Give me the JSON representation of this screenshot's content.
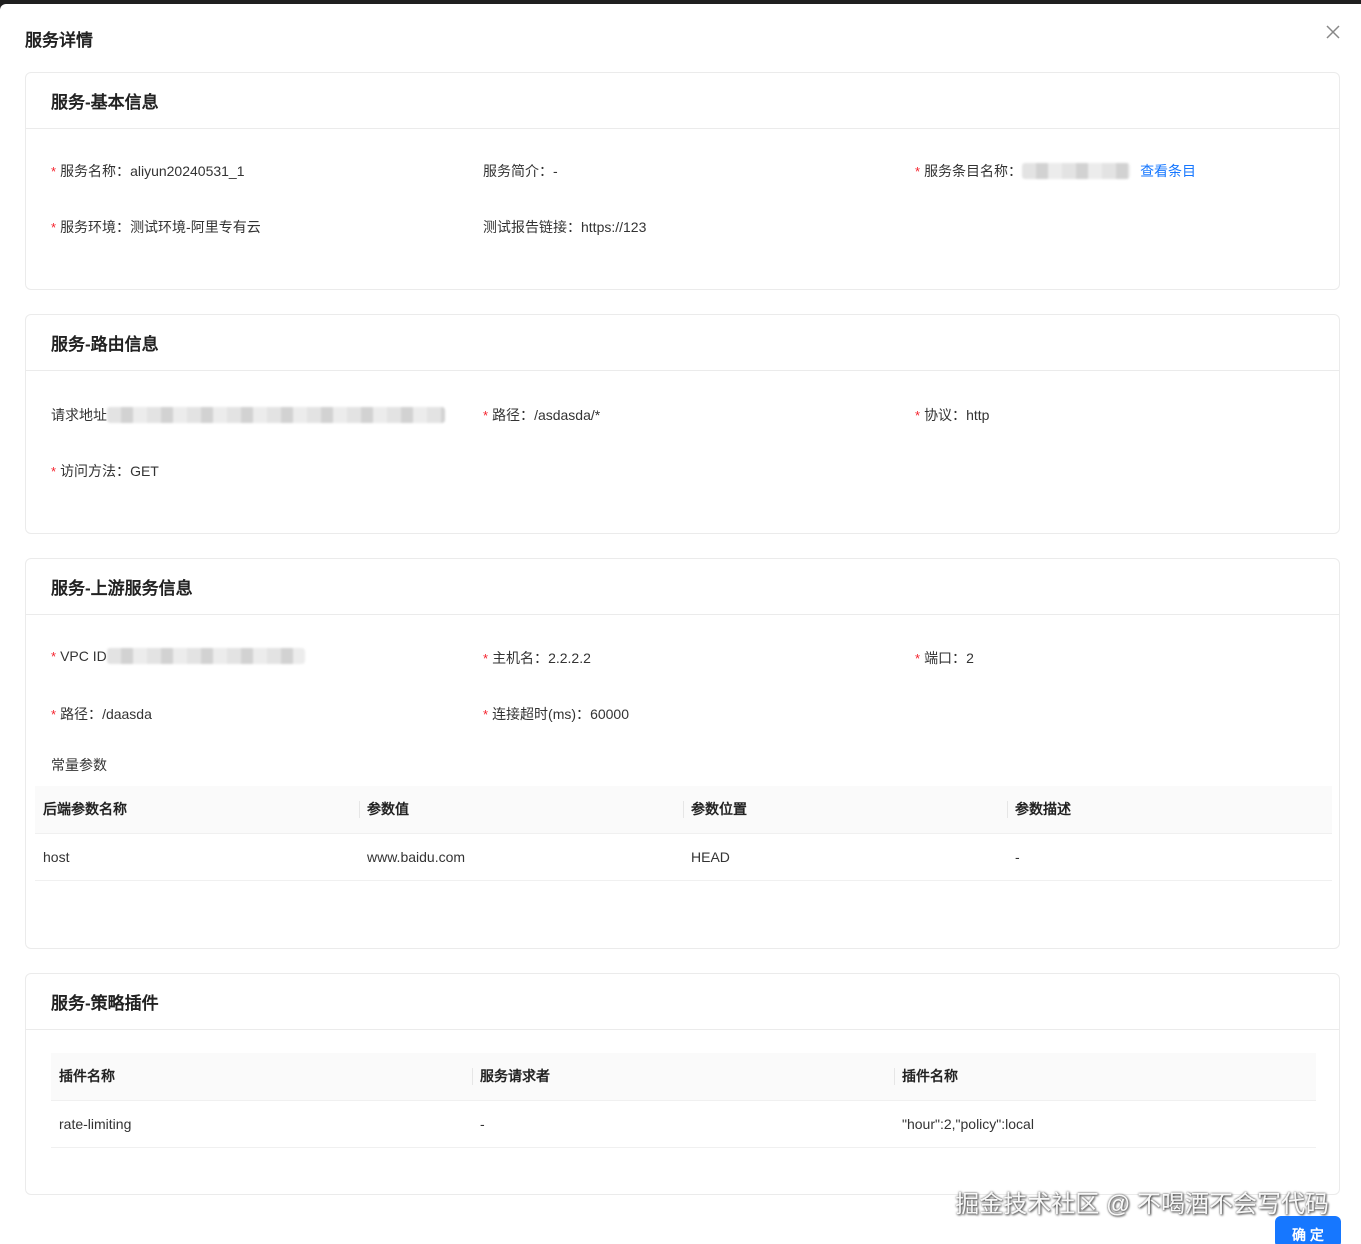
{
  "modal": {
    "title": "服务详情",
    "ok_label": "确 定"
  },
  "basic": {
    "title": "服务-基本信息",
    "name_label": "服务名称：",
    "name_value": "aliyun20240531_1",
    "intro_label": "服务简介：",
    "intro_value": "-",
    "item_label": "服务条目名称：",
    "item_link": "查看条目",
    "env_label": "服务环境：",
    "env_value": "测试环境-阿里专有云",
    "report_label": "测试报告链接：",
    "report_value": "https://123"
  },
  "route": {
    "title": "服务-路由信息",
    "addr_label": "请求地址",
    "path_label": "路径：",
    "path_value": "/asdasda/*",
    "proto_label": "协议：",
    "proto_value": "http",
    "method_label": "访问方法：",
    "method_value": "GET"
  },
  "upstream": {
    "title": "服务-上游服务信息",
    "vpc_label": "VPC ID",
    "host_label": "主机名：",
    "host_value": "2.2.2.2",
    "port_label": "端口：",
    "port_value": "2",
    "path_label": "路径：",
    "path_value": "/daasda",
    "timeout_label": "连接超时(ms)：",
    "timeout_value": "60000",
    "params_label": "常量参数",
    "params_headers": [
      "后端参数名称",
      "参数值",
      "参数位置",
      "参数描述"
    ],
    "params_rows": [
      [
        "host",
        "www.baidu.com",
        "HEAD",
        "-"
      ]
    ]
  },
  "plugins": {
    "title": "服务-策略插件",
    "headers": [
      "插件名称",
      "服务请求者",
      "插件名称"
    ],
    "rows": [
      [
        "rate-limiting",
        "-",
        "\"hour\":2,\"policy\":local"
      ]
    ]
  },
  "watermark": "掘金技术社区 @ 不喝酒不会写代码"
}
